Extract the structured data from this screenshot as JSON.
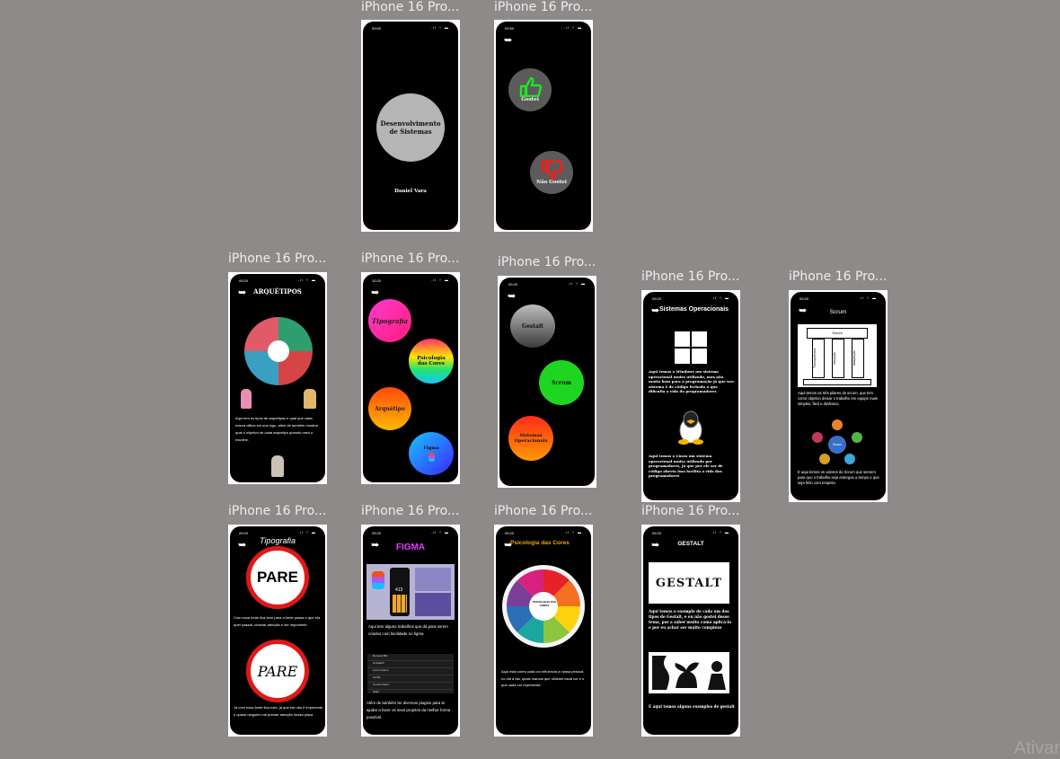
{
  "frame_label": "iPhone 16 Pro...",
  "watermark": "Ativar",
  "times": {
    "a": "09:50",
    "b": "09:50",
    "c": "09:20",
    "d": "10:20",
    "e": "09:20",
    "f": "09:20",
    "g": "09:20",
    "h": "09:20",
    "i": "09:20",
    "j": "09:20",
    "k": "09:20"
  },
  "f1": {
    "circle_title": "Desenvolvimento de Sistemas",
    "author": "Daniel Vara"
  },
  "f2": {
    "like": "Gostei",
    "dislike": "Não Gostei"
  },
  "f3": {
    "title": "ARQUÉTIPOS",
    "body": "Aqui tem os tipos de arquétipos e qual que cada marca utiliza em sua logo, além de também mostrar qual o objetivo de cada arquétipo quando mexi o escolhe."
  },
  "f4": {
    "b1": "Tipografia",
    "b2": "Psicologia das Cores",
    "b3": "Arquétipo",
    "b4": "Figma"
  },
  "f5": {
    "b1": "Gestalt",
    "b2": "Scrum",
    "b3": "Sistemas Operacionais"
  },
  "f6": {
    "title": "Sistemas Operacionais",
    "p1": "Aqui temos o Windows um sistema operacional muito utilizado, mas não muito bom para a programação já que seu sistema é de código fechado o que dificulta a vida do programadores",
    "p2": "Aqui temos o Linux um sistema operacional muito utilizado por programadores, já que por ele ser de código aberto isso facilita a vida dos programadores"
  },
  "f7": {
    "title": "Scrum",
    "temple": "Scrum",
    "pillars": [
      "Transparência",
      "Inspeção",
      "Adaptação"
    ],
    "p1": "Aqui temos os três pilares do scrum, que tem como objetivo deixar o trabalho em equipe mais simples, fácil e dinâmico.",
    "center": "Scrum",
    "p2": "E aqui temos os valores do Scrum que servem para que o trabalho seja entregue a tempo e que seja feito com respeito"
  },
  "f8": {
    "title": "Tipografia",
    "sign1": "PARE",
    "p1": "Com essa fonte fica bom para a fonte passa o que ela quer passar, chamar atenção e ser imponente",
    "sign2": "PARE",
    "p2": "Já com essa fonte fica ruim, já que ela não é imponente e quase ninguém vai prestar atenção nessa placa"
  },
  "f9": {
    "title": "FIGMA",
    "big": "413",
    "p1": "Aqui tem alguns trabalhos que dá para serem criados com facilidade no figma",
    "p2": "Além de também ter diversos plugins para te ajudar a fazer os seus projetos da melhor forma possível.",
    "plugins": [
      "Remove BG",
      "Unsplash",
      "Lorem Ipsum",
      "Iconify",
      "Content Reel",
      "Stark"
    ]
  },
  "f10": {
    "title": "Psicologia das Cores",
    "wheel": "PSICOLOGIA DAS CORES",
    "p1": "Aqui está cores cada cor influencia a nossa pessoa no dia a dia, quais marcas que utilizam cada cor e o que cada cor representa."
  },
  "f11": {
    "title": "GESTALT",
    "logo": "GESTALT",
    "p1": "Aqui temos o exemplo de cada um dos tipos de Gestalt, e eu não gostei desse tema, por a saber muito como aplicá-lo e por eu achar ser muito complexo",
    "p2": "E aqui temos alguns exemplos de gestalt"
  }
}
